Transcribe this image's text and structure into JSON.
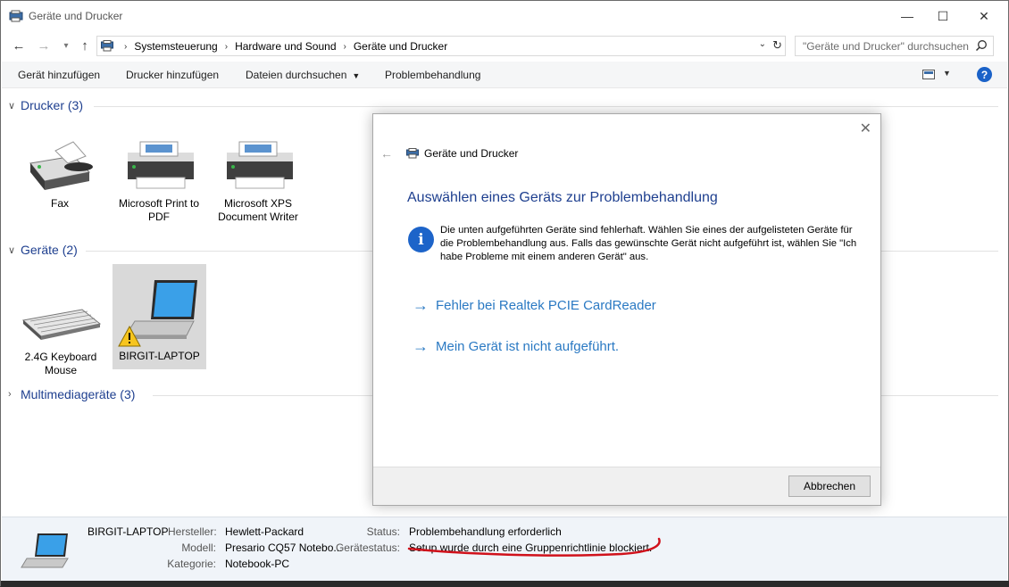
{
  "window": {
    "title": "Geräte und Drucker",
    "minimize_glyph": "—",
    "maximize_glyph": "☐",
    "close_glyph": "✕"
  },
  "nav": {
    "back_glyph": "←",
    "forward_glyph": "→",
    "recent_glyph": "▾",
    "up_glyph": "↑"
  },
  "address": {
    "crumbs": [
      "Systemsteuerung",
      "Hardware und Sound",
      "Geräte und Drucker"
    ],
    "separator": "›",
    "dropdown_glyph": "⌄",
    "refresh_glyph": "↻"
  },
  "search": {
    "placeholder": "\"Geräte und Drucker\" durchsuchen"
  },
  "commandbar": {
    "add_device": "Gerät hinzufügen",
    "add_printer": "Drucker hinzufügen",
    "browse_files": "Dateien durchsuchen",
    "browse_caret": "▼",
    "troubleshoot": "Problembehandlung",
    "view_caret": "▼",
    "help": "?"
  },
  "groups": {
    "printers": {
      "label": "Drucker (3)",
      "chevron": "∨"
    },
    "devices": {
      "label": "Geräte (2)",
      "chevron": "∨"
    },
    "multimedia": {
      "label": "Multimediageräte (3)",
      "chevron": "›"
    }
  },
  "printers": [
    {
      "name": "Fax",
      "icon": "fax-icon"
    },
    {
      "name": "Microsoft Print to PDF",
      "icon": "printer-icon"
    },
    {
      "name": "Microsoft XPS Document Writer",
      "icon": "printer-icon"
    }
  ],
  "devices": [
    {
      "name": "2.4G Keyboard Mouse",
      "icon": "keyboard-icon"
    },
    {
      "name": "BIRGIT-LAPTOP",
      "icon": "laptop-icon",
      "warning": true
    }
  ],
  "details": {
    "name": "BIRGIT-LAPTOP",
    "manufacturer_label": "Hersteller:",
    "manufacturer": "Hewlett-Packard",
    "model_label": "Modell:",
    "model": "Presario CQ57 Notebo...",
    "category_label": "Kategorie:",
    "category": "Notebook-PC",
    "status_label": "Status:",
    "status": "Problembehandlung erforderlich",
    "device_status_label": "Gerätestatus:",
    "device_status": "Setup wurde durch eine Gruppenrichtlinie blockiert."
  },
  "dialog": {
    "close_glyph": "✕",
    "back_glyph": "←",
    "breadcrumb": "Geräte und Drucker",
    "heading": "Auswählen eines Geräts zur Problembehandlung",
    "info_glyph": "i",
    "info_text": "Die unten aufgeführten Geräte sind fehlerhaft. Wählen Sie eines der aufgelisteten Geräte für die Problembehandlung aus. Falls das gewünschte Gerät nicht aufgeführt ist, wählen Sie \"Ich habe Probleme mit einem anderen Gerät\" aus.",
    "options": [
      {
        "arrow": "→",
        "label": "Fehler bei Realtek PCIE CardReader"
      },
      {
        "arrow": "→",
        "label": "Mein Gerät ist nicht aufgeführt."
      }
    ],
    "cancel": "Abbrechen"
  },
  "colors": {
    "group_heading": "#1e3f8f",
    "link": "#2a79c3",
    "annotation_underline": "#d0111b"
  }
}
